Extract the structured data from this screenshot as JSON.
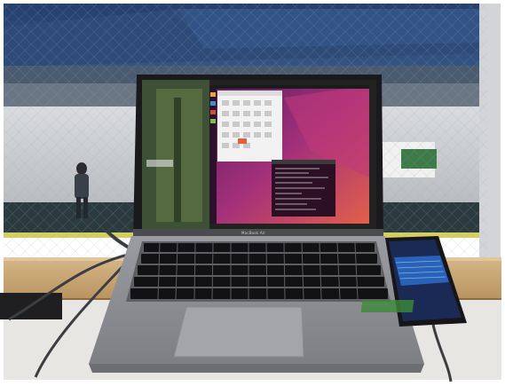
{
  "photo": {
    "laptop_badge": "MacBook Air"
  },
  "palette": {
    "roof_blue": "#2d4a78",
    "platform_floor": "#2a3a3e",
    "wood_ledge": "#c9a778",
    "laptop_body": "#8d8f93",
    "ubuntu_purple": "#8a2a6e",
    "terminal_bg": "#2c0f25",
    "phone_screen": "#1b2a55"
  }
}
